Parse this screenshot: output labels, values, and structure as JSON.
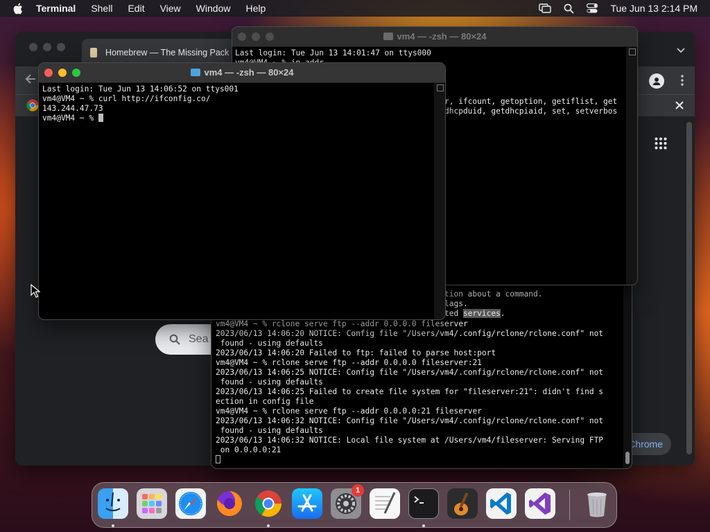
{
  "menubar": {
    "app": "Terminal",
    "items": [
      "Shell",
      "Edit",
      "View",
      "Window",
      "Help"
    ],
    "clock": "Tue Jun 13  2:14 PM"
  },
  "chrome": {
    "tab_title": "Homebrew — The Missing Pack",
    "search_placeholder": "Sea",
    "customize_label": "Chrome"
  },
  "term_front": {
    "title": "vm4 — -zsh — 80×24",
    "lines": [
      "Last login: Tue Jun 13 14:06:52 on ttys001",
      "vm4@VM4 ~ % curl http://ifconfig.co/",
      "143.244.47.73",
      "vm4@VM4 ~ % "
    ]
  },
  "term_back": {
    "title": "vm4 — -zsh — 80×24",
    "lines": [
      "Last login: Tue Jun 13 14:01:47 on ttys000",
      "vm4@VM4 ~ % ip addr"
    ],
    "right_fragments": [
      "r, ifcount, getoption, getiflist, get",
      "dhcpduid, getdhcpiaid, set, setverbos"
    ]
  },
  "term_bottom": {
    "top_fragments": [
      "tion about a command.",
      "lags.",
      "ted services."
    ],
    "lines": [
      "vm4@VM4 ~ % rclone serve ftp --addr 0.0.0.0 fileserver",
      "2023/06/13 14:06:20 NOTICE: Config file \"/Users/vm4/.config/rclone/rclone.conf\" not",
      " found - using defaults",
      "2023/06/13 14:06:20 Failed to ftp: failed to parse host:port",
      "vm4@VM4 ~ % rclone serve ftp --addr 0.0.0.0 fileserver:21",
      "2023/06/13 14:06:25 NOTICE: Config file \"/Users/vm4/.config/rclone/rclone.conf\" not",
      " found - using defaults",
      "2023/06/13 14:06:25 Failed to create file system for \"fileserver:21\": didn't find s",
      "ection in config file",
      "vm4@VM4 ~ % rclone serve ftp --addr 0.0.0.0:21 fileserver",
      "2023/06/13 14:06:32 NOTICE: Config file \"/Users/vm4/.config/rclone/rclone.conf\" not",
      " found - using defaults",
      "2023/06/13 14:06:32 NOTICE: Local file system at /Users/vm4/fileserver: Serving FTP",
      " on 0.0.0.0:21"
    ]
  },
  "dock": {
    "apps": [
      "finder",
      "launchpad",
      "safari",
      "firefox",
      "chrome",
      "app-store",
      "system-settings",
      "textedit",
      "terminal",
      "garageband",
      "vscode",
      "visual-studio",
      "trash"
    ],
    "settings_badge": "1"
  }
}
